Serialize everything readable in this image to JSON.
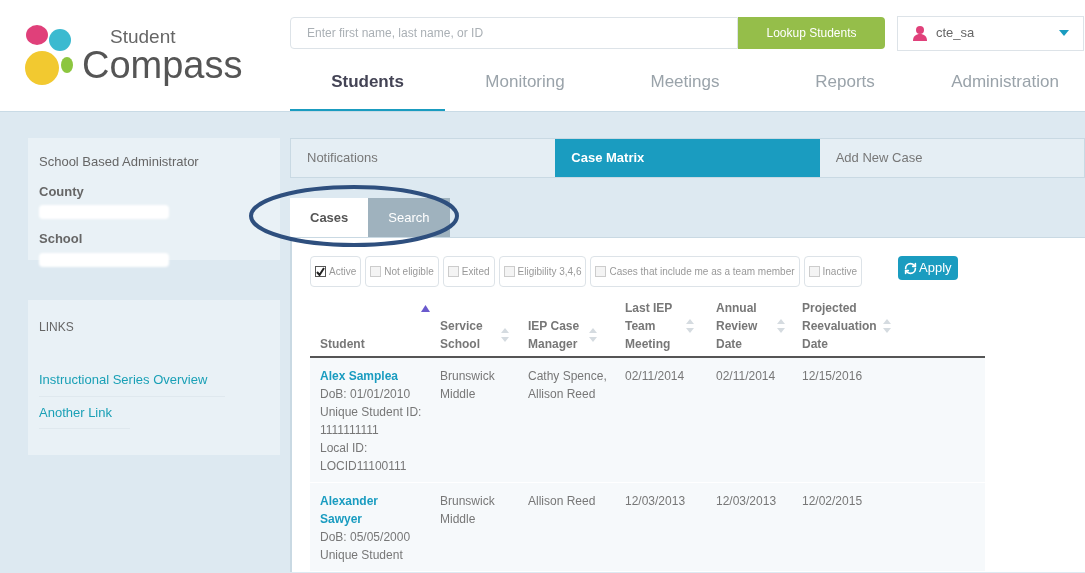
{
  "header": {
    "logo": {
      "line1": "Student",
      "line2": "Compass"
    },
    "search": {
      "placeholder": "Enter first name, last name, or ID"
    },
    "lookup_button": "Lookup Students",
    "user": {
      "name": "cte_sa"
    },
    "nav": [
      {
        "label": "Students",
        "selected": true
      },
      {
        "label": "Monitoring",
        "selected": false
      },
      {
        "label": "Meetings",
        "selected": false
      },
      {
        "label": "Reports",
        "selected": false
      },
      {
        "label": "Administration",
        "selected": false
      }
    ]
  },
  "sidebar": {
    "role": "School Based Administrator",
    "fields": [
      "County",
      "School"
    ],
    "links_title": "LINKS",
    "links": [
      "Instructional Series Overview",
      "Another Link"
    ]
  },
  "main_tabs": [
    {
      "label": "Notifications",
      "selected": false
    },
    {
      "label": "Case Matrix",
      "selected": true
    },
    {
      "label": "Add New Case",
      "selected": false
    }
  ],
  "sub_tabs": [
    {
      "label": "Cases",
      "selected": true
    },
    {
      "label": "Search",
      "selected": false
    }
  ],
  "filters": [
    {
      "label": "Active",
      "checked": true
    },
    {
      "label": "Not eligible",
      "checked": false
    },
    {
      "label": "Exited",
      "checked": false
    },
    {
      "label": "Eligibility 3,4,6",
      "checked": false
    },
    {
      "label": "Cases that include me as a team member",
      "checked": false
    },
    {
      "label": "Inactive",
      "checked": false
    }
  ],
  "apply_button": "Apply",
  "table": {
    "columns": [
      {
        "label": "Student",
        "sorted": true
      },
      {
        "label": "Service School",
        "sorted": false
      },
      {
        "label": "IEP Case Manager",
        "sorted": false
      },
      {
        "label": "Last IEP Team Meeting",
        "sorted": false
      },
      {
        "label": "Annual Review Date",
        "sorted": false
      },
      {
        "label": "Projected Reevaluation Date",
        "sorted": false
      }
    ],
    "rows": [
      {
        "cells": [
          {
            "kind": "student",
            "name": "Alex Samplea",
            "details": [
              "DoB: 01/01/2010",
              "Unique Student ID: 1111111111",
              "Local ID: LOCID11100111"
            ]
          },
          {
            "kind": "text",
            "text": "Brunswick Middle"
          },
          {
            "kind": "text",
            "text": "Cathy Spence, Allison Reed"
          },
          {
            "kind": "text",
            "text": "02/11/2014"
          },
          {
            "kind": "text",
            "text": "02/11/2014"
          },
          {
            "kind": "text",
            "text": "12/15/2016"
          }
        ]
      },
      {
        "cells": [
          {
            "kind": "student",
            "name": "Alexander Sawyer",
            "details": [
              "DoB: 05/05/2000",
              "Unique Student"
            ]
          },
          {
            "kind": "text",
            "text": "Brunswick Middle"
          },
          {
            "kind": "text",
            "text": "Allison Reed"
          },
          {
            "kind": "text",
            "text": "12/03/2013"
          },
          {
            "kind": "text",
            "text": "12/03/2013"
          },
          {
            "kind": "text",
            "text": "12/02/2015"
          }
        ]
      }
    ]
  }
}
